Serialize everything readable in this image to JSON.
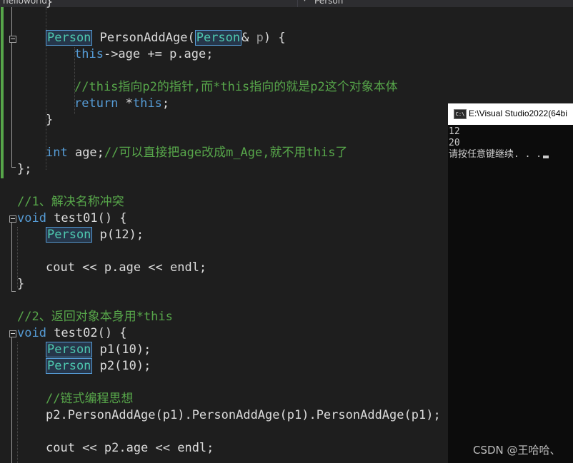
{
  "editor": {
    "project_name": "helloworld",
    "scope_dropdown_icon": "dropdown-arrow-icon",
    "class_scope": "Person",
    "lines": {
      "l2_a": "Person",
      "l2_b": " PersonAddAge(",
      "l2_c": "Person",
      "l2_d": "& ",
      "l2_e": "p",
      "l2_f": ") {",
      "l3_a": "this",
      "l3_b": "->age += p.age;",
      "l5": "//this指向p2的指针,而*this指向的就是p2这个对象本体",
      "l6_a": "return",
      "l6_b": " *",
      "l6_c": "this",
      "l6_d": ";",
      "l7": "}",
      "l9_a": "int",
      "l9_b": " age;",
      "l9_c": "//可以直接把age改成m_Age,就不用this了",
      "l10": "};",
      "l12": "//1、解决名称冲突",
      "l13_a": "void",
      "l13_b": " test01() {",
      "l14_a": "Person",
      "l14_b": " p(12);",
      "l16": "cout << p.age << endl;",
      "l17": "}",
      "l19": "//2、返回对象本身用*this",
      "l20_a": "void",
      "l20_b": " test02() {",
      "l21_a": "Person",
      "l21_b": " p1(10);",
      "l22_a": "Person",
      "l22_b": " p2(10);",
      "l24": "//链式编程思想",
      "l25": "p2.PersonAddAge(p1).PersonAddAge(p1).PersonAddAge(p1);",
      "l27": "cout << p2.age << endl;"
    }
  },
  "console": {
    "icon_label": "C:\\",
    "title": "E:\\Visual Studio2022(64bi",
    "output": [
      "12",
      "20",
      "请按任意键继续. . ."
    ]
  },
  "watermark": "CSDN @王哈哈、"
}
